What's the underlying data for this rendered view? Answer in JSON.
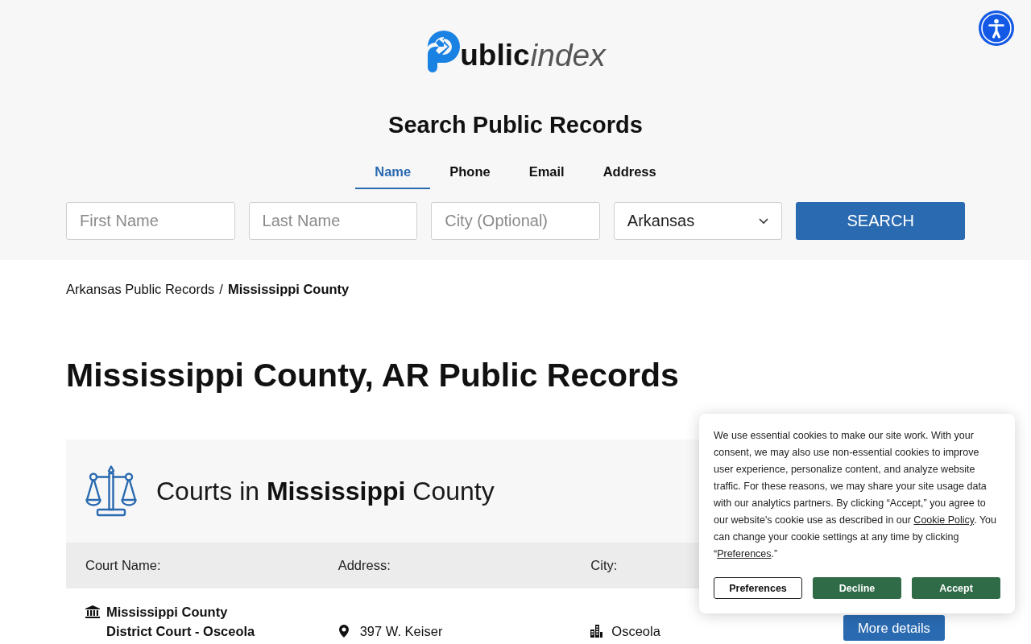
{
  "header": {
    "logo": {
      "bold": "ublic",
      "light": "index"
    }
  },
  "search": {
    "title": "Search Public Records",
    "tabs": [
      {
        "label": "Name",
        "selected": true
      },
      {
        "label": "Phone",
        "selected": false
      },
      {
        "label": "Email",
        "selected": false
      },
      {
        "label": "Address",
        "selected": false
      }
    ],
    "fields": [
      {
        "kind": "input",
        "placeholder": "First Name"
      },
      {
        "kind": "input",
        "placeholder": "Last Name"
      },
      {
        "kind": "input",
        "placeholder": "City (Optional)"
      },
      {
        "kind": "select",
        "value": "Arkansas"
      }
    ],
    "button": "SEARCH"
  },
  "breadcrumb": {
    "items": [
      {
        "kind": "link",
        "label": "Arkansas Public Records"
      },
      {
        "kind": "current",
        "label": "Mississippi County"
      }
    ],
    "separator": "/"
  },
  "page_title": "Mississippi County, AR Public Records",
  "courts": {
    "heading": "Courts in **Mississippi** County",
    "columns": [
      "Court Name:",
      "Address:",
      "City:"
    ],
    "rows": [
      {
        "name": "Mississippi County District Court - Osceola",
        "address": "397 W. Keiser",
        "city": "Osceola",
        "button": "More details"
      }
    ]
  },
  "cookie_banner": {
    "message": [
      {
        "kind": "text",
        "text": "We use essential cookies to make our site work. With your consent, we may also use non-essential cookies to improve user experience, personalize content, and analyze website traffic. For these reasons, we may share your site usage data with our analytics partners. By clicking “Accept,” you agree to our website's cookie use as described in our "
      },
      {
        "kind": "link",
        "text": "Cookie Policy"
      },
      {
        "kind": "text",
        "text": ". You can change your cookie settings at any time by clicking “"
      },
      {
        "kind": "link",
        "text": "Preferences"
      },
      {
        "kind": "text",
        "text": ".”"
      }
    ],
    "buttons": [
      {
        "kind": "outline",
        "label": "Preferences"
      },
      {
        "kind": "filled",
        "label": "Decline"
      },
      {
        "kind": "filled",
        "label": "Accept"
      }
    ]
  }
}
